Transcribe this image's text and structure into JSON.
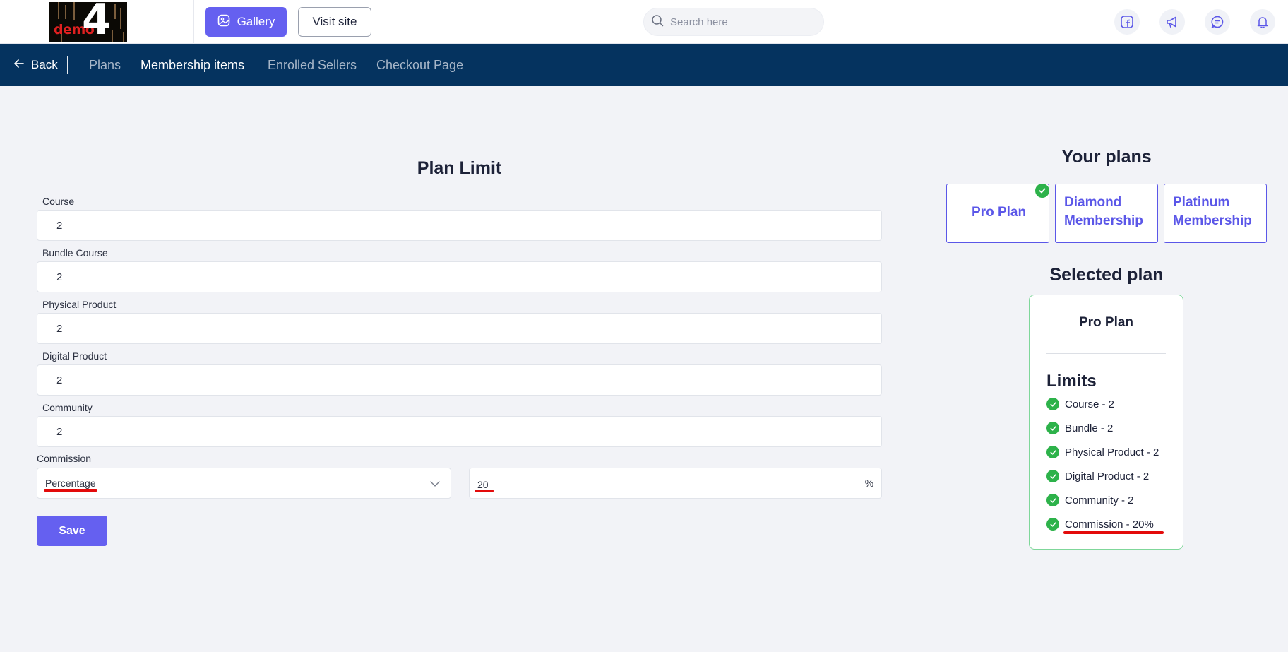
{
  "topbar": {
    "logo_text": "demo",
    "logo_number": "4",
    "gallery_label": "Gallery",
    "visit_site_label": "Visit site",
    "search_placeholder": "Search here",
    "icons": [
      "facebook-icon",
      "megaphone-icon",
      "chat-icon",
      "bell-icon"
    ]
  },
  "nav": {
    "back_label": "Back",
    "tabs": [
      {
        "label": "Plans",
        "active": false
      },
      {
        "label": "Membership items",
        "active": true
      },
      {
        "label": "Enrolled Sellers",
        "active": false
      },
      {
        "label": "Checkout Page",
        "active": false
      }
    ]
  },
  "form": {
    "title": "Plan Limit",
    "fields": [
      {
        "label": "Course",
        "value": "2"
      },
      {
        "label": "Bundle Course",
        "value": "2"
      },
      {
        "label": "Physical Product",
        "value": "2"
      },
      {
        "label": "Digital Product",
        "value": "2"
      },
      {
        "label": "Community",
        "value": "2"
      }
    ],
    "commission": {
      "label": "Commission",
      "type_value": "Percentage",
      "amount_value": "20",
      "unit": "%"
    },
    "save_label": "Save"
  },
  "plans": {
    "title": "Your plans",
    "cards": [
      {
        "line1": "Pro Plan",
        "line2": "",
        "selected": true
      },
      {
        "line1": "Diamond",
        "line2": "Membership",
        "selected": false
      },
      {
        "line1": "Platinum",
        "line2": "Membership",
        "selected": false
      }
    ]
  },
  "selected_plan": {
    "title": "Selected plan",
    "name": "Pro Plan",
    "limits_title": "Limits",
    "limits": [
      "Course - 2",
      "Bundle - 2",
      "Physical Product - 2",
      "Digital Product - 2",
      "Community - 2",
      "Commission - 20%"
    ]
  },
  "colors": {
    "accent": "#6560f0",
    "nav_bg": "#05335f",
    "success": "#2db24a",
    "highlight": "#e30b0b"
  }
}
